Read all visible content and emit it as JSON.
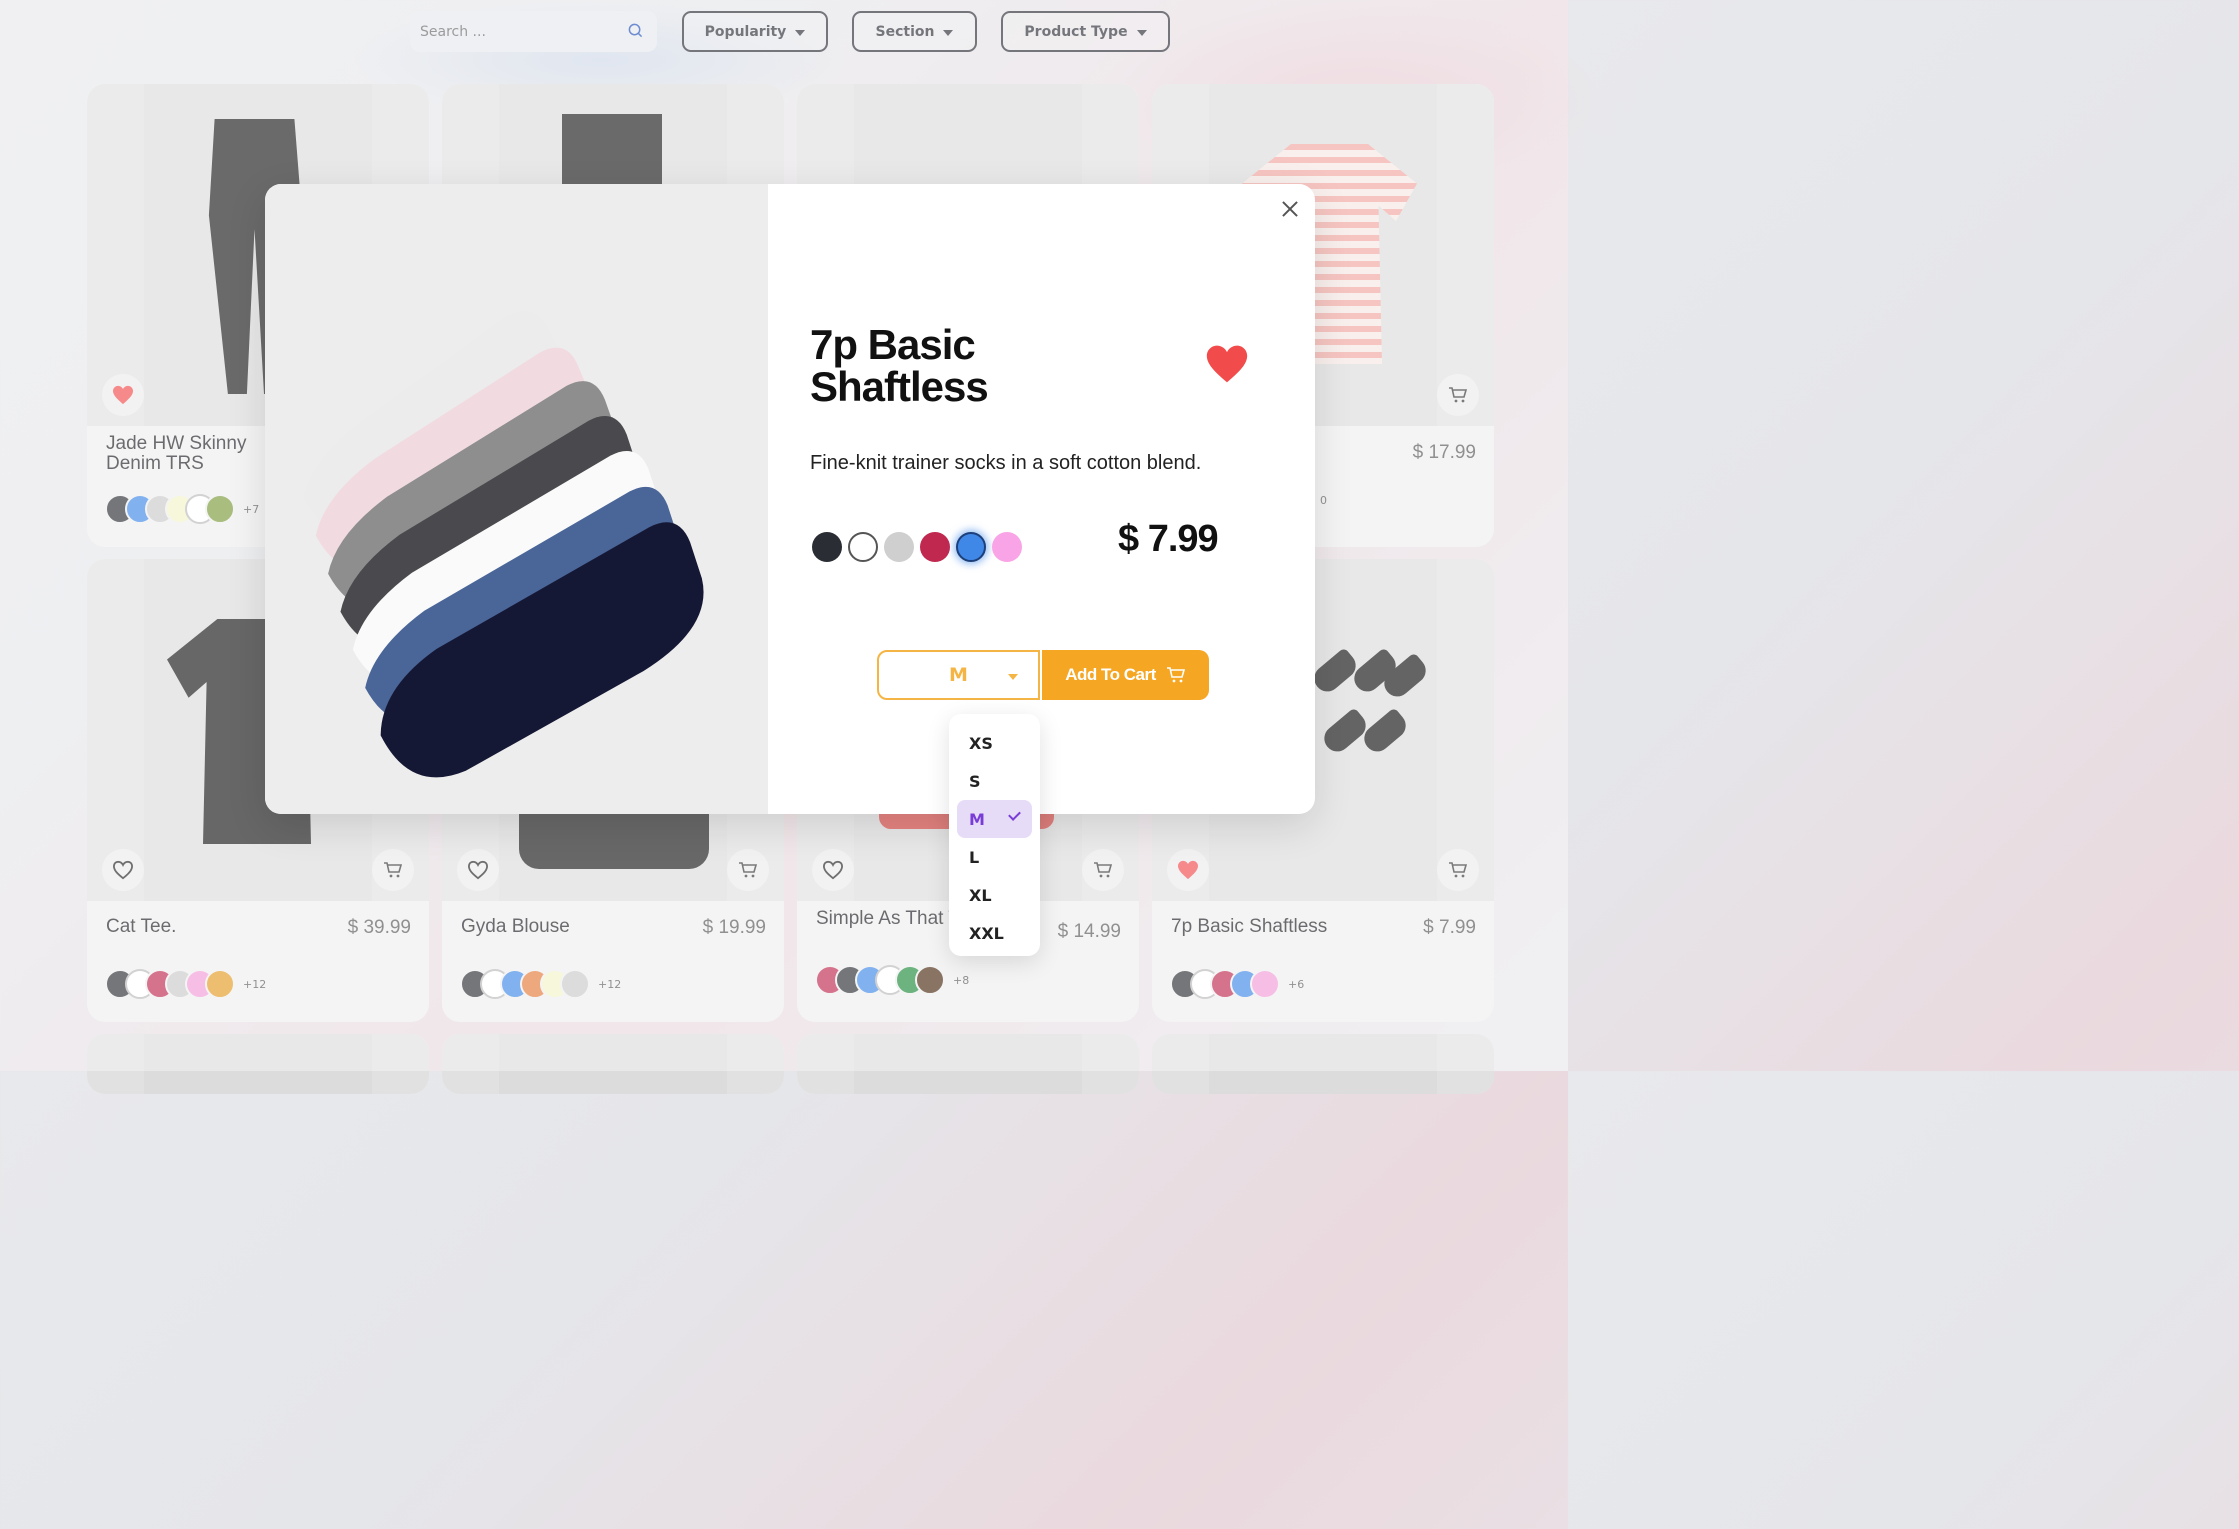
{
  "toolbar": {
    "search_placeholder": "Search ...",
    "filters": [
      "Popularity",
      "Section",
      "Product Type"
    ]
  },
  "colors": {
    "accent": "#f5a623",
    "accent_outline": "#f5b545",
    "favorite": "#f24b4b",
    "selected_bg": "#e6dcf8",
    "selected_text": "#7a3cd6"
  },
  "products": [
    {
      "name": "Jade HW Skinny Denim TRS",
      "price": "",
      "favorited": true,
      "swatches": [
        "#2a2d33",
        "#3f88e8",
        "#c9c9c9",
        "#f3f3c8",
        "#ffffff",
        "#7a9a3a"
      ],
      "more": "+7"
    },
    {
      "name": "",
      "price": "",
      "favorited": false,
      "swatches": [],
      "more": ""
    },
    {
      "name": "",
      "price": "",
      "favorited": false,
      "swatches": [],
      "more": ""
    },
    {
      "name": "",
      "price": "$ 17.99",
      "favorited": false,
      "swatches": [],
      "more": "0"
    },
    {
      "name": "Cat Tee.",
      "price": "$ 39.99",
      "favorited": false,
      "swatches": [
        "#2a2d33",
        "#ffffff",
        "#c0284f",
        "#c9c9c9",
        "#f29bd8",
        "#e49b22"
      ],
      "more": "+12"
    },
    {
      "name": "Gyda Blouse",
      "price": "$ 19.99",
      "favorited": false,
      "swatches": [
        "#2a2d33",
        "#ffffff",
        "#3f88e8",
        "#e57a3a",
        "#f3f3c8",
        "#c9c9c9"
      ],
      "more": "+12"
    },
    {
      "name": "Simple As That Triangle Top",
      "price": "$ 14.99",
      "favorited": false,
      "swatches": [
        "#c0284f",
        "#2a2d33",
        "#3f88e8",
        "#ffffff",
        "#1e8a3c",
        "#4a2a12"
      ],
      "more": "+8"
    },
    {
      "name": "7p Basic Shaftless",
      "price": "$ 7.99",
      "favorited": true,
      "swatches": [
        "#2a2d33",
        "#ffffff",
        "#c0284f",
        "#3f88e8",
        "#f29bd8"
      ],
      "more": "+6"
    }
  ],
  "modal": {
    "title": "7p Basic Shaftless",
    "description": "Fine-knit trainer socks in a soft cotton blend.",
    "price": "$ 7.99",
    "favorited": true,
    "colors": [
      "#2a2d33",
      "#ffffff",
      "#cfcfcf",
      "#c0284f",
      "#3f88e8",
      "#f9a4e6"
    ],
    "selected_color_index": 4,
    "size_value": "M",
    "add_to_cart_label": "Add To Cart",
    "size_options": [
      "XS",
      "S",
      "M",
      "L",
      "XL",
      "XXL"
    ],
    "selected_size": "M"
  }
}
